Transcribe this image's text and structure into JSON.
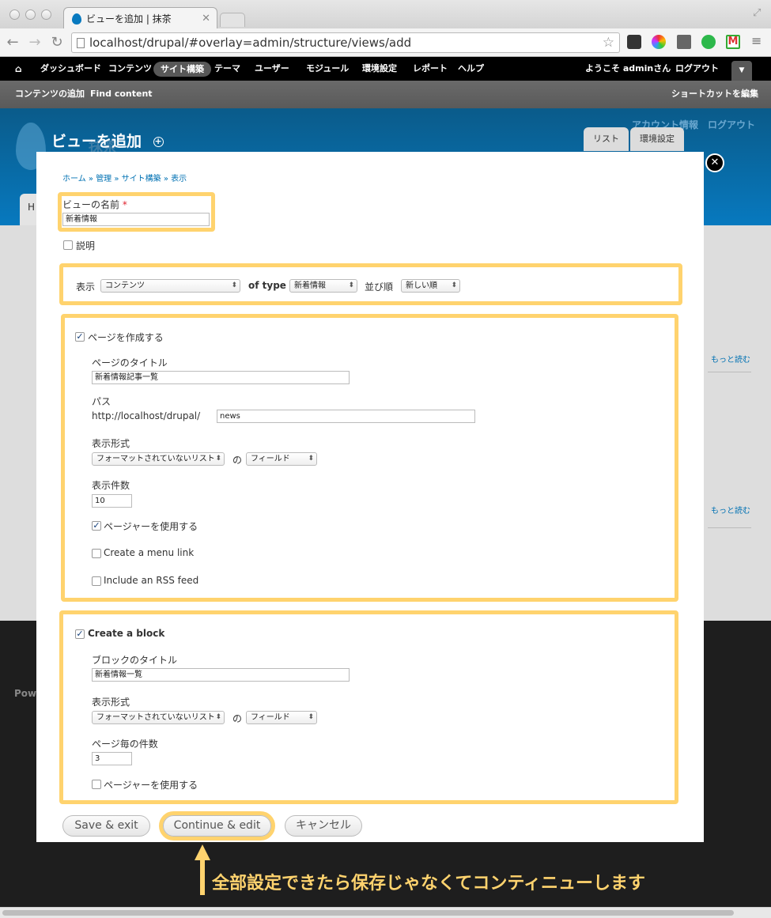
{
  "browser": {
    "tab_title": "ビューを追加 | 抹茶",
    "url": "localhost/drupal/#overlay=admin/structure/views/add"
  },
  "toolbar": {
    "items": [
      "ダッシュボード",
      "コンテンツ",
      "サイト構築",
      "テーマ",
      "ユーザー",
      "モジュール",
      "環境設定",
      "レポート",
      "ヘルプ"
    ],
    "welcome": "ようこそ adminさん",
    "logout": "ログアウト",
    "shortcuts": [
      "コンテンツの追加",
      "Find content"
    ],
    "edit_shortcuts": "ショートカットを編集"
  },
  "behind": {
    "account": "アカウント情報",
    "logout": "ログアウト",
    "site_name": "抹茶",
    "home_tab": "H",
    "read_more_1": "もっと読む",
    "read_more_2": "もっと読む",
    "powered": "Powe"
  },
  "overlay": {
    "title": "ビューを追加",
    "tabs": [
      "リスト",
      "環境設定"
    ],
    "breadcrumb": [
      "ホーム",
      "管理",
      "サイト構築",
      "表示"
    ]
  },
  "form": {
    "view_name_label": "ビューの名前",
    "required_mark": "*",
    "view_name_value": "新着情報",
    "description_label": "説明",
    "show_label": "表示",
    "show_value": "コンテンツ",
    "of_type_label": "of type",
    "type_value": "新着情報",
    "sort_label": "並び順",
    "sort_value": "新しい順",
    "page": {
      "create_label": "ページを作成する",
      "title_label": "ページのタイトル",
      "title_value": "新着情報記事一覧",
      "path_label": "パス",
      "path_prefix": "http://localhost/drupal/",
      "path_value": "news",
      "format_label": "表示形式",
      "format_value": "フォーマットされていないリスト",
      "of_label": "の",
      "field_value": "フィールド",
      "items_label": "表示件数",
      "items_value": "10",
      "pager_label": "ページャーを使用する",
      "menu_link_label": "Create a menu link",
      "rss_label": "Include an RSS feed"
    },
    "block": {
      "create_label": "Create a block",
      "title_label": "ブロックのタイトル",
      "title_value": "新着情報一覧",
      "format_label": "表示形式",
      "format_value": "フォーマットされていないリスト",
      "of_label": "の",
      "field_value": "フィールド",
      "items_label": "ページ毎の件数",
      "items_value": "3",
      "pager_label": "ページャーを使用する"
    },
    "buttons": {
      "save_exit": "Save & exit",
      "continue_edit": "Continue & edit",
      "cancel": "キャンセル"
    }
  },
  "annotation": "全部設定できたら保存じゃなくてコンティニューします",
  "colors": {
    "highlight": "#ffd36e",
    "link": "#0071b3",
    "drupal_blue": "#0779bf"
  }
}
